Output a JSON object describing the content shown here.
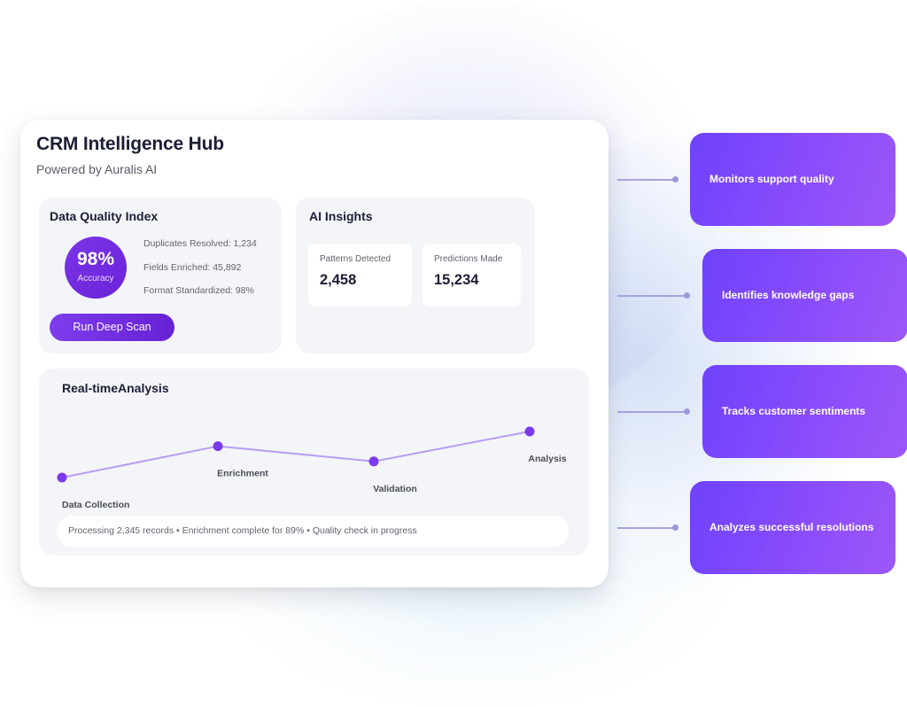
{
  "hub": {
    "title": "CRM Intelligence Hub",
    "subtitle": "Powered by Auralis AI"
  },
  "data_quality": {
    "title": "Data Quality Index",
    "accuracy_value": "98%",
    "accuracy_label": "Accuracy",
    "stats": [
      "Duplicates Resolved: 1,234",
      "Fields Enriched: 45,892",
      "Format Standardized: 98%"
    ],
    "button_label": "Run Deep Scan"
  },
  "ai_insights": {
    "title": "AI Insights",
    "cards": [
      {
        "label": "Patterns Detected",
        "value": "2,458"
      },
      {
        "label": "Predictions Made",
        "value": "15,234"
      }
    ]
  },
  "realtime": {
    "title": "Real-timeAnalysis",
    "status": "Processing 2,345 records • Enrichment complete for 89% • Quality check in progress",
    "pipeline": {
      "stages": [
        "Data Collection",
        "Enrichment",
        "Validation",
        "Analysis"
      ],
      "relative_levels": [
        0.0,
        0.68,
        0.35,
        1.0
      ]
    }
  },
  "features": [
    "Monitors support quality",
    "Identifies knowledge gaps",
    "Tracks customer sentiments",
    "Analyzes successful resolutions"
  ],
  "colors": {
    "accent": "#7c3aed",
    "line": "#b79cf5",
    "feature_start": "#6e42fb",
    "feature_end": "#9d57f7",
    "connector": "#a6a3de"
  }
}
